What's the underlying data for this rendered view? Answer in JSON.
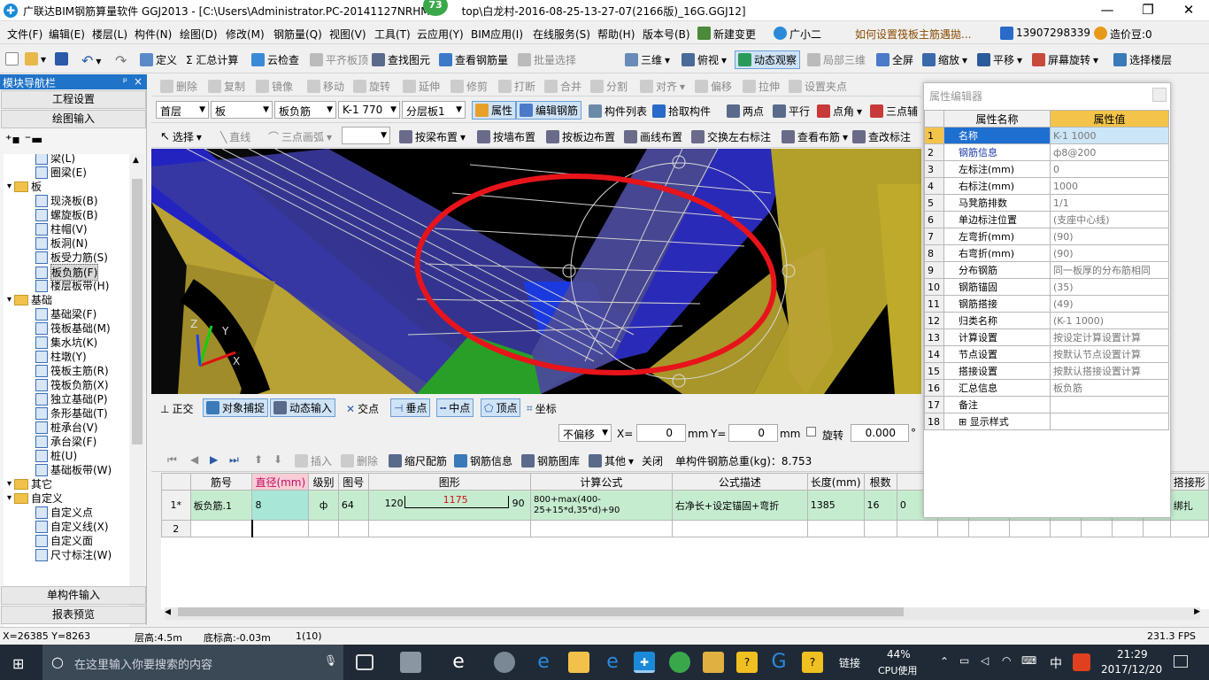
{
  "window": {
    "title": "广联达BIM钢筋算量软件 GGJ2013 - [C:\\Users\\Administrator.PC-20141127NRHM\\Desktop\\白龙村-2016-08-25-13-27-07(2166版)_16G.GGJ12]",
    "title_left": "广联达BIM钢筋算量软件 GGJ2013 - [C:\\Users\\Administrator.PC-20141127NRHM",
    "title_right": "top\\白龙村-2016-08-25-13-27-07(2166版)_16G.GGJ12]",
    "badge": "73"
  },
  "menubar": {
    "items": [
      "文件(F)",
      "编辑(E)",
      "楼层(L)",
      "构件(N)",
      "绘图(D)",
      "修改(M)",
      "钢筋量(Q)",
      "视图(V)",
      "工具(T)",
      "云应用(Y)",
      "BIM应用(I)",
      "在线服务(S)",
      "帮助(H)",
      "版本号(B)"
    ],
    "new_change": "新建变更",
    "assistant": "广小二",
    "question": "如何设置筏板主筋遇拋...",
    "phone": "13907298339",
    "bean": "造价豆:0"
  },
  "toolbar1": {
    "items": [
      "定义",
      "Σ 汇总计算",
      "云检查",
      "平齐板顶",
      "查找图元",
      "查看钢筋量",
      "批量选择",
      "三维",
      "俯视",
      "动态观察",
      "局部三维",
      "全屏",
      "缩放",
      "平移",
      "屏幕旋转",
      "选择楼层"
    ]
  },
  "toolbar2": {
    "items": [
      "删除",
      "复制",
      "镜像",
      "移动",
      "旋转",
      "延伸",
      "修剪",
      "打断",
      "合并",
      "分割",
      "对齐",
      "偏移",
      "拉伸",
      "设置夹点"
    ]
  },
  "toolbar3": {
    "floor": "首层",
    "type": "板",
    "sub_type": "板负筋",
    "component": "K-1 770",
    "layer": "分层板1",
    "items": [
      "属性",
      "编辑钢筋",
      "构件列表",
      "拾取构件",
      "两点",
      "平行",
      "点角",
      "三点辅"
    ]
  },
  "toolbar4": {
    "items": [
      "选择",
      "直线",
      "三点画弧",
      "按梁布置",
      "按墙布置",
      "按板边布置",
      "画线布置",
      "交换左右标注",
      "查看布筋",
      "查改标注"
    ]
  },
  "leftpanel": {
    "title": "模块导航栏",
    "btn_project": "工程设置",
    "btn_drawing": "绘图输入",
    "btn_single": "单构件输入",
    "btn_report": "报表预览",
    "tree": [
      {
        "label": "梁(L)",
        "level": 2,
        "folder": false
      },
      {
        "label": "圈梁(E)",
        "level": 2,
        "folder": false
      },
      {
        "label": "板",
        "level": 1,
        "folder": true
      },
      {
        "label": "现浇板(B)",
        "level": 2,
        "folder": false
      },
      {
        "label": "螺旋板(B)",
        "level": 2,
        "folder": false
      },
      {
        "label": "柱帽(V)",
        "level": 2,
        "folder": false
      },
      {
        "label": "板洞(N)",
        "level": 2,
        "folder": false
      },
      {
        "label": "板受力筋(S)",
        "level": 2,
        "folder": false
      },
      {
        "label": "板负筋(F)",
        "level": 2,
        "folder": false,
        "selected": true
      },
      {
        "label": "楼层板带(H)",
        "level": 2,
        "folder": false
      },
      {
        "label": "基础",
        "level": 1,
        "folder": true
      },
      {
        "label": "基础梁(F)",
        "level": 2,
        "folder": false
      },
      {
        "label": "筏板基础(M)",
        "level": 2,
        "folder": false
      },
      {
        "label": "集水坑(K)",
        "level": 2,
        "folder": false
      },
      {
        "label": "柱墩(Y)",
        "level": 2,
        "folder": false
      },
      {
        "label": "筏板主筋(R)",
        "level": 2,
        "folder": false
      },
      {
        "label": "筏板负筋(X)",
        "level": 2,
        "folder": false
      },
      {
        "label": "独立基础(P)",
        "level": 2,
        "folder": false
      },
      {
        "label": "条形基础(T)",
        "level": 2,
        "folder": false
      },
      {
        "label": "桩承台(V)",
        "level": 2,
        "folder": false
      },
      {
        "label": "承台梁(F)",
        "level": 2,
        "folder": false
      },
      {
        "label": "桩(U)",
        "level": 2,
        "folder": false
      },
      {
        "label": "基础板带(W)",
        "level": 2,
        "folder": false
      },
      {
        "label": "其它",
        "level": 1,
        "folder": true
      },
      {
        "label": "自定义",
        "level": 1,
        "folder": true
      },
      {
        "label": "自定义点",
        "level": 2,
        "folder": false
      },
      {
        "label": "自定义线(X)",
        "level": 2,
        "folder": false
      },
      {
        "label": "自定义面",
        "level": 2,
        "folder": false
      },
      {
        "label": "尺寸标注(W)",
        "level": 2,
        "folder": false
      }
    ]
  },
  "snapbar": {
    "items": [
      "正交",
      "对象捕捉",
      "动态输入",
      "交点",
      "垂点",
      "中点",
      "顶点",
      "坐标"
    ]
  },
  "offsetbar": {
    "mode": "不偏移",
    "x_label": "X=",
    "x_value": "0",
    "unit1": "mm",
    "y_label": "Y=",
    "y_value": "0",
    "unit2": "mm",
    "rotate_label": "旋转",
    "rotate_value": "0.000",
    "deg": "°"
  },
  "gridtb": {
    "items": [
      "插入",
      "删除",
      "缩尺配筋",
      "钢筋信息",
      "钢筋图库",
      "其他",
      "关闭"
    ],
    "total": "单构件钢筋总重(kg)：8.753"
  },
  "grid": {
    "headers": [
      "",
      "筋号",
      "直径(mm)",
      "级别",
      "图号",
      "图形",
      "计算公式",
      "公式描述",
      "长度(mm)",
      "根数",
      "",
      "",
      "",
      "",
      "",
      "",
      "",
      "",
      "搭接形"
    ],
    "rows": [
      {
        "num": "1*",
        "name": "板负筋.1",
        "dia": "8",
        "grade": "ф",
        "fig": "64",
        "left": "120",
        "mid": "1175",
        "right": "90",
        "formula": "800+max(400-25+15*d,35*d)+90",
        "desc": "右净长+设定锚固+弯折",
        "len": "1385",
        "count": "16",
        "extra": "0",
        "lap": "绑扎"
      },
      {
        "num": "2",
        "name": "",
        "dia": "",
        "grade": "",
        "fig": "",
        "left": "",
        "mid": "",
        "right": "",
        "formula": "",
        "desc": "",
        "len": "",
        "count": "",
        "extra": "",
        "lap": ""
      }
    ]
  },
  "props": {
    "title": "属性编辑器",
    "col_name": "属性名称",
    "col_value": "属性值",
    "rows": [
      {
        "n": "1",
        "name": "名称",
        "value": "K-1 1000",
        "blue": true,
        "sel": true
      },
      {
        "n": "2",
        "name": "钢筋信息",
        "value": "ф8@200",
        "blue": true
      },
      {
        "n": "3",
        "name": "左标注(mm)",
        "value": "0"
      },
      {
        "n": "4",
        "name": "右标注(mm)",
        "value": "1000"
      },
      {
        "n": "5",
        "name": "马凳筋排数",
        "value": "1/1"
      },
      {
        "n": "6",
        "name": "单边标注位置",
        "value": "(支座中心线)"
      },
      {
        "n": "7",
        "name": "左弯折(mm)",
        "value": "(90)"
      },
      {
        "n": "8",
        "name": "右弯折(mm)",
        "value": "(90)"
      },
      {
        "n": "9",
        "name": "分布钢筋",
        "value": "同一板厚的分布筋相同"
      },
      {
        "n": "10",
        "name": "钢筋锚固",
        "value": "(35)"
      },
      {
        "n": "11",
        "name": "钢筋搭接",
        "value": "(49)"
      },
      {
        "n": "12",
        "name": "归类名称",
        "value": "(K-1 1000)"
      },
      {
        "n": "13",
        "name": "计算设置",
        "value": "按设定计算设置计算"
      },
      {
        "n": "14",
        "name": "节点设置",
        "value": "按默认节点设置计算"
      },
      {
        "n": "15",
        "name": "搭接设置",
        "value": "按默认搭接设置计算"
      },
      {
        "n": "16",
        "name": "汇总信息",
        "value": "板负筋"
      },
      {
        "n": "17",
        "name": "备注",
        "value": ""
      },
      {
        "n": "18",
        "name": "⊞ 显示样式",
        "value": ""
      }
    ]
  },
  "statusbar": {
    "coords": "X=26385 Y=8263",
    "floor_h": "层高:4.5m",
    "base_h": "底标高:-0.03m",
    "count": "1(10)",
    "fps": "231.3 FPS"
  },
  "taskbar": {
    "search": "在这里输入你要搜索的内容",
    "link": "链接",
    "cpu_pct": "44%",
    "cpu_label": "CPU使用",
    "ime": "中",
    "time": "21:29",
    "date": "2017/12/20"
  },
  "colors": {
    "accent": "#1f73c8",
    "highlight_ellipse": "#e8141b",
    "selected_row": "#c6ecd0"
  }
}
